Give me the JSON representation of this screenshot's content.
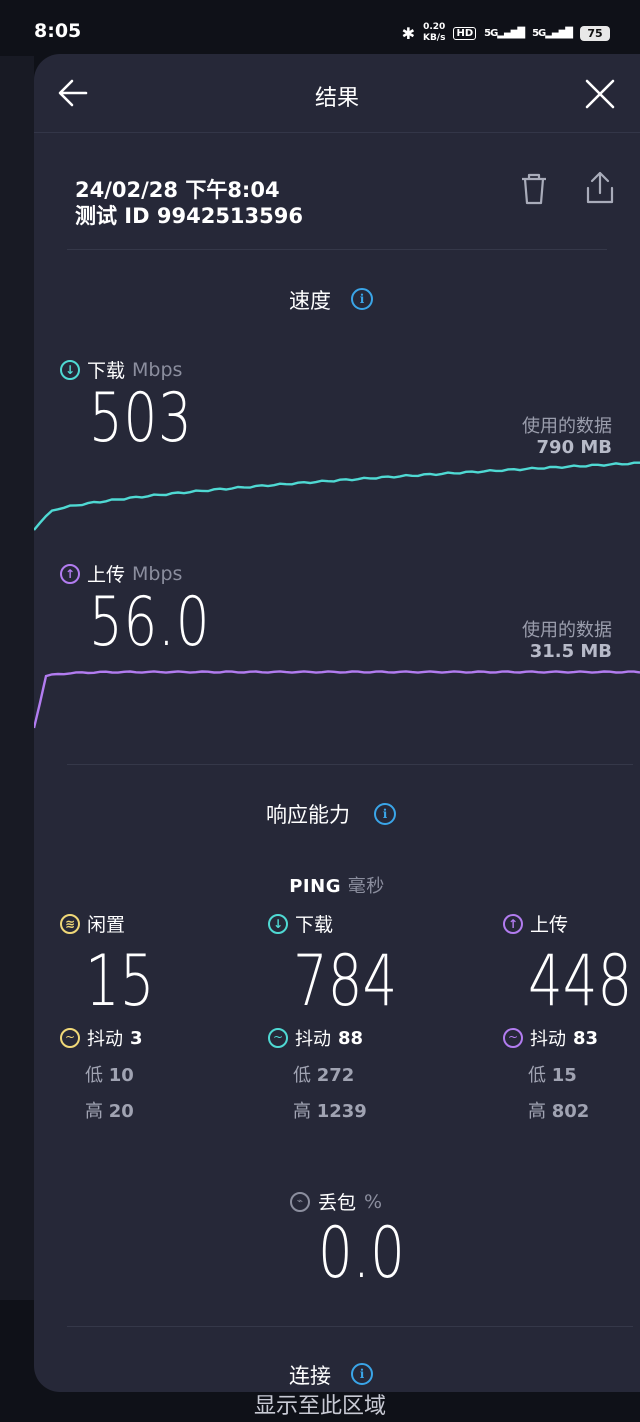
{
  "status_bar": {
    "time": "8:05",
    "net_speed_value": "0.20",
    "net_speed_unit": "KB/s",
    "hd_label": "HD",
    "signal1_label": "5G",
    "signal2_label": "5G",
    "battery": "75"
  },
  "header": {
    "title": "结果"
  },
  "test": {
    "date": "24/02/28 下午8:04",
    "id_label": "测试 ID 9942513596"
  },
  "speed": {
    "section_title": "速度",
    "download": {
      "label": "下载",
      "unit": "Mbps",
      "value": "503",
      "data_used_label": "使用的数据",
      "data_used_value": "790 MB"
    },
    "upload": {
      "label": "上传",
      "unit": "Mbps",
      "value": "56.0",
      "data_used_label": "使用的数据",
      "data_used_value": "31.5 MB"
    }
  },
  "responsiveness": {
    "section_title": "响应能力",
    "ping_label": "PING",
    "ping_unit": "毫秒",
    "idle": {
      "label": "闲置",
      "value": "15",
      "jitter_label": "抖动",
      "jitter": "3",
      "low_label": "低",
      "low": "10",
      "high_label": "高",
      "high": "20"
    },
    "download": {
      "label": "下载",
      "value": "784",
      "jitter_label": "抖动",
      "jitter": "88",
      "low_label": "低",
      "low": "272",
      "high_label": "高",
      "high": "1239"
    },
    "upload": {
      "label": "上传",
      "value": "448",
      "jitter_label": "抖动",
      "jitter": "83",
      "low_label": "低",
      "low": "15",
      "high_label": "高",
      "high": "802"
    },
    "packet_loss": {
      "label": "丢包",
      "unit": "%",
      "value": "0.0"
    }
  },
  "connection": {
    "section_title": "连接"
  },
  "bottom_overlay_text": "显示至此区域",
  "colors": {
    "download": "#4fd9d3",
    "upload": "#b27cf0",
    "idle": "#f0d878",
    "info": "#3aa5e8",
    "panel": "#262838"
  }
}
